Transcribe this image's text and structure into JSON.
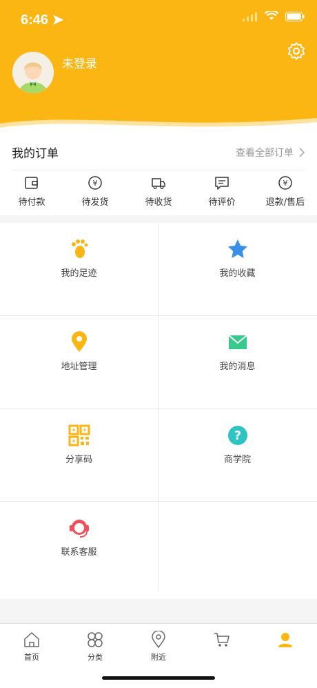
{
  "status": {
    "time": "6:46"
  },
  "profile": {
    "login_status": "未登录"
  },
  "orders": {
    "title": "我的订单",
    "view_all": "查看全部订单",
    "items": [
      {
        "label": "待付款",
        "icon": "wallet-icon"
      },
      {
        "label": "待发货",
        "icon": "yen-circle-icon"
      },
      {
        "label": "待收货",
        "icon": "truck-icon"
      },
      {
        "label": "待评价",
        "icon": "comment-icon"
      },
      {
        "label": "退款/售后",
        "icon": "refund-icon"
      }
    ]
  },
  "menu": [
    {
      "label": "我的足迹",
      "icon": "footprint-icon",
      "color": "#fbb614"
    },
    {
      "label": "我的收藏",
      "icon": "star-icon",
      "color": "#3a8fe8"
    },
    {
      "label": "地址管理",
      "icon": "location-pin-icon",
      "color": "#fbb614"
    },
    {
      "label": "我的消息",
      "icon": "mail-icon",
      "color": "#38c98c"
    },
    {
      "label": "分享码",
      "icon": "qr-code-icon",
      "color": "#fbb614"
    },
    {
      "label": "商学院",
      "icon": "question-icon",
      "color": "#2ec4c4"
    },
    {
      "label": "联系客服",
      "icon": "headset-icon",
      "color": "#f0505a"
    }
  ],
  "tabbar": [
    {
      "label": "首页",
      "icon": "home-icon"
    },
    {
      "label": "分类",
      "icon": "category-icon"
    },
    {
      "label": "附近",
      "icon": "location-icon"
    },
    {
      "label": "",
      "icon": "cart-icon"
    },
    {
      "label": "",
      "icon": "user-icon"
    }
  ],
  "colors": {
    "brand": "#fbb614"
  }
}
